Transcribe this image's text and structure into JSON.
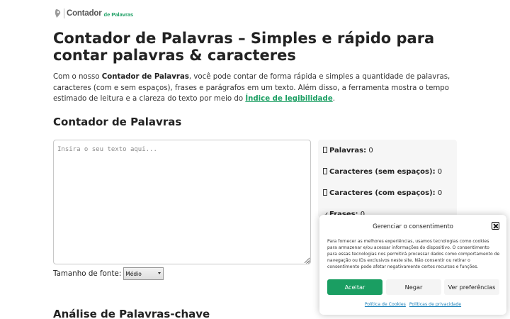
{
  "header": {
    "logo_main": "Contador",
    "logo_sub": "de Palavras"
  },
  "page_title": "Contador de Palavras – Simples e rápido para contar palavras & caracteres",
  "intro": {
    "prefix": "Com o nosso ",
    "bold": "Contador de Palavras",
    "middle": ", você pode contar de forma rápida e simples a quantidade de palavras, caracteres (com e sem espaços), frases e parágrafos em um texto. Além disso, a ferramenta mostra o tempo estimado de leitura e a clareza do texto por meio do ",
    "link": "Índice de legibilidade",
    "suffix": "."
  },
  "counter": {
    "section_title": "Contador de Palavras",
    "placeholder": "Insira o seu texto aqui...",
    "font_label": "Tamanho de fonte:",
    "font_selected": "Médio"
  },
  "stats": [
    {
      "label": "Palavras:",
      "value": "0"
    },
    {
      "label": "Caracteres (sem espaços):",
      "value": "0"
    },
    {
      "label": "Caracteres (com espaços):",
      "value": "0"
    },
    {
      "label": "Frases:",
      "value": "0"
    }
  ],
  "keywords_section_title": "Análise de Palavras-chave",
  "consent": {
    "title": "Gerenciar o consentimento",
    "body": "Para fornecer as melhores experiências, usamos tecnologias como cookies para armazenar e/ou acessar informações do dispositivo. O consentimento para essas tecnologias nos permitirá processar dados como comportamento de navegação ou IDs exclusivos neste site. Não consentir ou retirar o consentimento pode afetar negativamente certos recursos e funções.",
    "accept": "Aceitar",
    "deny": "Negar",
    "preferences": "Ver preferências",
    "cookie_policy": "Política de Cookies",
    "privacy_policy": "Políticas de privacidade"
  },
  "colors": {
    "accent": "#1a9e62",
    "link": "#1a7fb8"
  }
}
